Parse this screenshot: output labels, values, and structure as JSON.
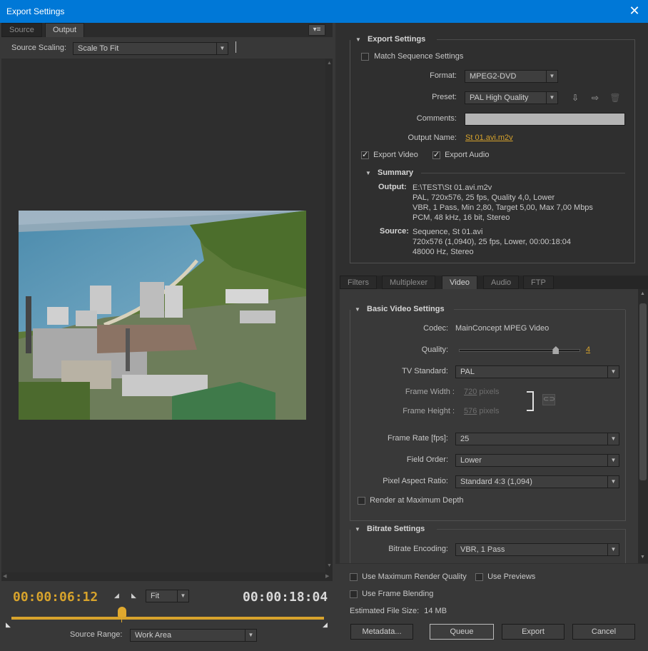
{
  "window": {
    "title": "Export Settings",
    "close": "✕"
  },
  "left": {
    "tabs": [
      "Source",
      "Output"
    ],
    "panel_menu": "▾≡",
    "source_scaling": {
      "label": "Source Scaling:",
      "value": "Scale To Fit"
    },
    "timecode_current": "00:00:06:12",
    "timecode_total": "00:00:18:04",
    "zoom": "Fit",
    "source_range": {
      "label": "Source Range:",
      "value": "Work Area"
    }
  },
  "export": {
    "section": "Export Settings",
    "match_sequence": "Match Sequence Settings",
    "format_label": "Format:",
    "format": "MPEG2-DVD",
    "preset_label": "Preset:",
    "preset": "PAL High Quality",
    "comments_label": "Comments:",
    "output_name_label": "Output Name:",
    "output_name": "St 01.avi.m2v",
    "export_video": "Export Video",
    "export_audio": "Export Audio",
    "summary_title": "Summary",
    "summary_output_label": "Output:",
    "summary_output": [
      "E:\\TEST\\St 01.avi.m2v",
      "PAL, 720x576, 25 fps, Quality 4,0, Lower",
      "VBR, 1 Pass, Min 2,80, Target 5,00, Max 7,00 Mbps",
      "PCM, 48 kHz, 16 bit, Stereo"
    ],
    "summary_source_label": "Source:",
    "summary_source": [
      "Sequence, St 01.avi",
      "720x576 (1,0940), 25 fps, Lower, 00:00:18:04",
      "48000 Hz, Stereo"
    ]
  },
  "settings_tabs": [
    "Filters",
    "Multiplexer",
    "Video",
    "Audio",
    "FTP"
  ],
  "video": {
    "basic_title": "Basic Video Settings",
    "codec_label": "Codec:",
    "codec": "MainConcept MPEG Video",
    "quality_label": "Quality:",
    "quality": "4",
    "quality_fraction": 0.8,
    "tv_label": "TV Standard:",
    "tv": "PAL",
    "frame_width_label": "Frame Width :",
    "frame_width": "720",
    "frame_height_label": "Frame Height :",
    "frame_height": "576",
    "pixels": "pixels",
    "frame_rate_label": "Frame Rate [fps]:",
    "frame_rate": "25",
    "field_order_label": "Field Order:",
    "field_order": "Lower",
    "par_label": "Pixel Aspect Ratio:",
    "par": "Standard 4:3 (1,094)",
    "render_max_depth": "Render at Maximum Depth",
    "bitrate_title": "Bitrate Settings",
    "bitrate_encoding_label": "Bitrate Encoding:",
    "bitrate_encoding": "VBR, 1 Pass"
  },
  "bottom": {
    "max_render_quality": "Use Maximum Render Quality",
    "use_previews": "Use Previews",
    "frame_blending": "Use Frame Blending",
    "file_size_label": "Estimated File Size:",
    "file_size": "14 MB",
    "buttons": {
      "metadata": "Metadata...",
      "queue": "Queue",
      "export": "Export",
      "cancel": "Cancel"
    }
  },
  "colors": {
    "accent": "#0078d7",
    "timecode": "#d7a32c"
  },
  "icons": {
    "save_preset": "save-preset-icon",
    "import_preset": "import-preset-icon",
    "delete_preset": "trash-icon",
    "link": "link-icon"
  }
}
